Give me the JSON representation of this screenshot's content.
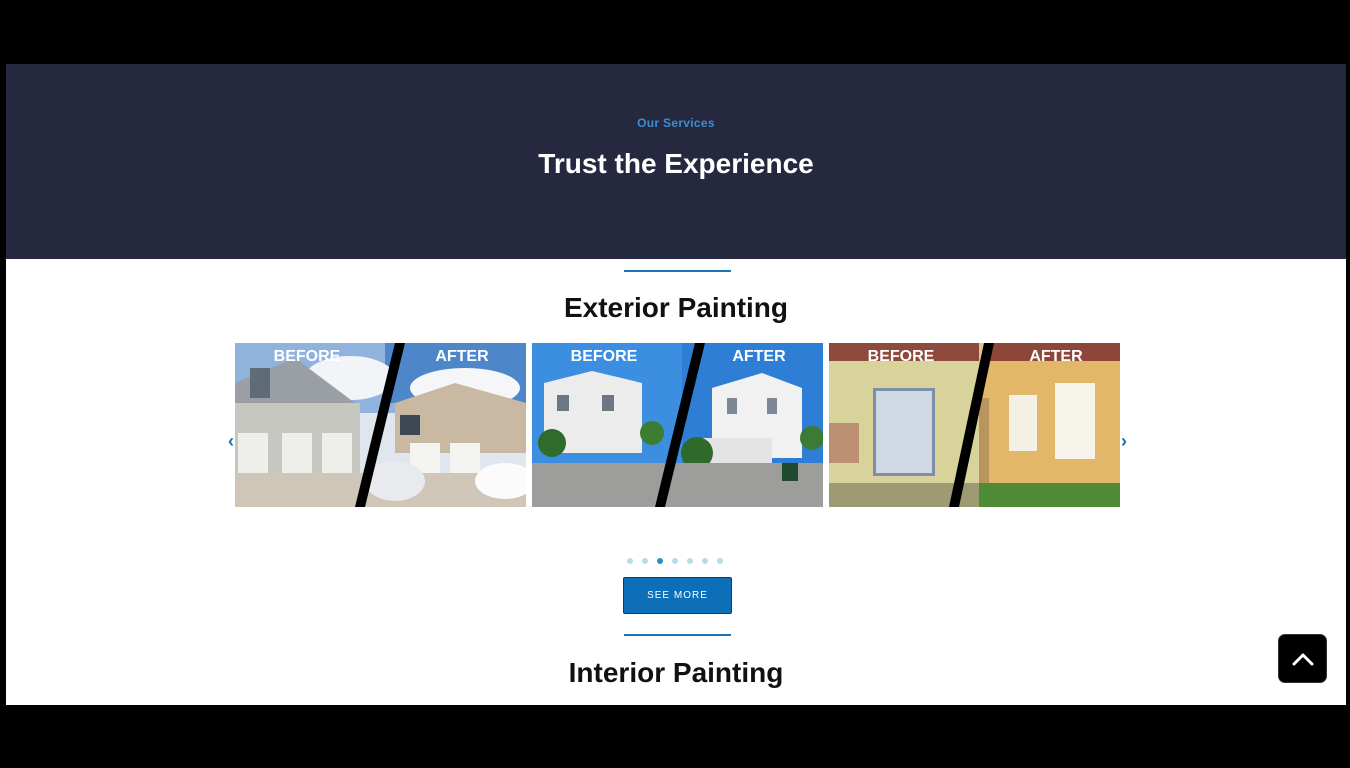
{
  "hero": {
    "eyebrow": "Our Services",
    "title": "Trust the Experience"
  },
  "exterior": {
    "title": "Exterior Painting",
    "slides": [
      {
        "before_label": "BEFORE",
        "after_label": "AFTER"
      },
      {
        "before_label": "BEFORE",
        "after_label": "AFTER"
      },
      {
        "before_label": "BEFORE",
        "after_label": "AFTER"
      }
    ],
    "pagination": {
      "count": 7,
      "active_index": 2
    },
    "see_more_label": "SEE MORE"
  },
  "interior": {
    "title": "Interior Painting"
  },
  "colors": {
    "hero_bg": "#262840",
    "accent": "#1d72b8",
    "button": "#0d6fb8"
  },
  "icons": {
    "prev": "chevron-left-icon",
    "next": "chevron-right-icon",
    "scroll_top": "chevron-up-icon"
  }
}
